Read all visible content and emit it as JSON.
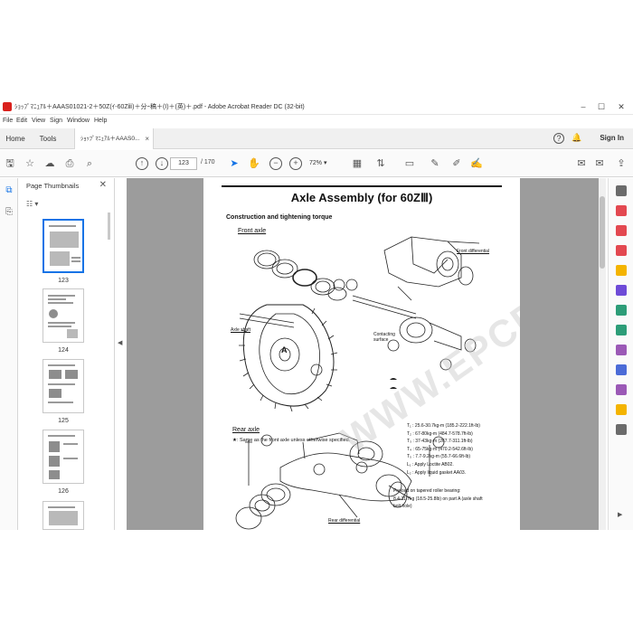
{
  "window": {
    "title": "ｼｮｯﾌﾟﾏﾆｭｱﾙ＋AAAS01021-2＋50Z(ｲ-60Zⅲ)＋分ｰ稿＋(I)＋(英)＋.pdf - Adobe Acrobat Reader DC (32-bit)"
  },
  "menu": [
    "File",
    "Edit",
    "View",
    "Sign",
    "Window",
    "Help"
  ],
  "tabs": {
    "home": "Home",
    "tools": "Tools",
    "document": "ｼｮｯﾌﾟﾏﾆｭｱﾙ＋AAAS0...",
    "close": "×"
  },
  "topright": {
    "help": "?",
    "bell": "🔔",
    "signin": "Sign In"
  },
  "toolbar": {
    "page_current": "123",
    "page_total": "/ 170",
    "zoom": "72%"
  },
  "thumbnails": {
    "header": "Page Thumbnails",
    "items": [
      {
        "label": "123",
        "selected": true
      },
      {
        "label": "124",
        "selected": false
      },
      {
        "label": "125",
        "selected": false
      },
      {
        "label": "126",
        "selected": false
      }
    ]
  },
  "page": {
    "title": "Axle Assembly (for 60ZⅢ)",
    "subtitle": "Construction and tightening torque",
    "front_axle": "Front axle",
    "front_differential": "Front differential",
    "axle_shaft": "Axle shaft",
    "contacting_surface": "Contacting surface",
    "rear_axle": "Rear axle",
    "same_note": "★: Same as the front axle unless otherwise specified.",
    "rear_differential": "Rear differential",
    "torque": [
      "T₁ : 25.6-30.7kg-m (185.2-222.1ft-lb)",
      "T₂ : 67-80kg-m (484.7-578.7ft-lb)",
      "T₃ : 37-43kg-m (267.7-311.1ft-lb)",
      "T₄ : 65-75kg-m (470.2-542.6ft-lb)",
      "T₅ : 7.7-9.2kg-m (55.7-66.6ft-lb)",
      "L₁ : Apply Loctite AB02.",
      "L₂ : Apply liquid gasket AA03."
    ],
    "preload": [
      "Preload on tapered roller bearing:",
      "8.4-11.7kg (18.5-25.8lb) on part A (axle shaft",
      "bolt hole)"
    ],
    "letter_a": "A",
    "watermark": "WWW.EPCDATO.COM"
  }
}
